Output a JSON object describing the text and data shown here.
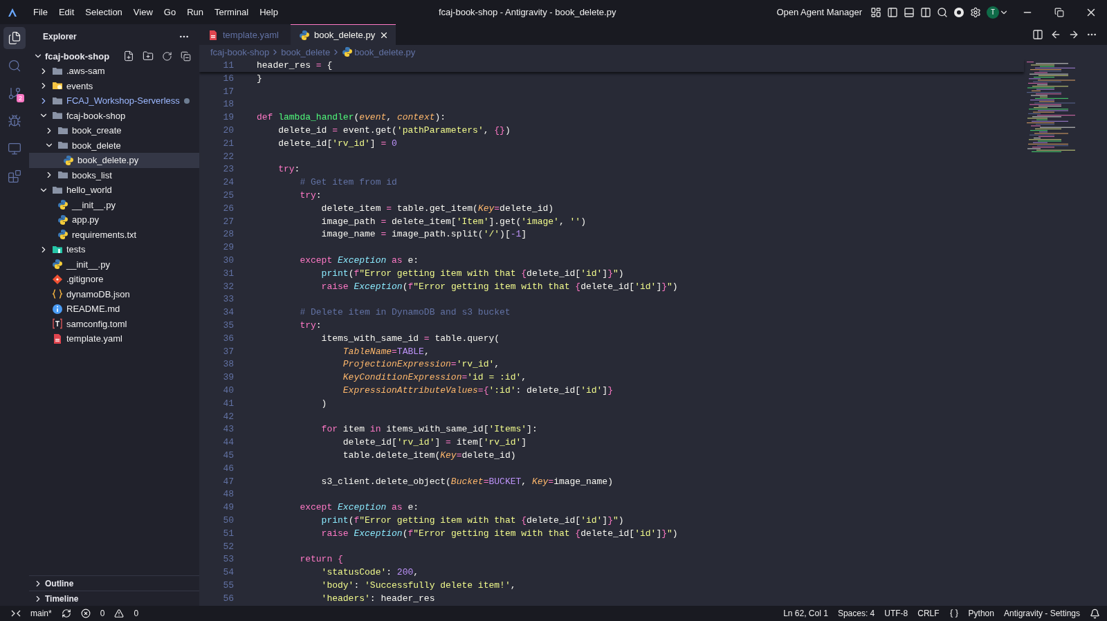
{
  "window": {
    "title": "fcaj-book-shop - Antigravity - book_delete.py",
    "menu": [
      "File",
      "Edit",
      "Selection",
      "View",
      "Go",
      "Run",
      "Terminal",
      "Help"
    ],
    "agent_button": "Open Agent Manager",
    "avatar": "T"
  },
  "activity_bar": [
    {
      "kind": "explorer",
      "selected": true
    },
    {
      "kind": "search",
      "selected": false
    },
    {
      "kind": "source-control",
      "selected": false,
      "badge": "2"
    },
    {
      "kind": "run-debug",
      "selected": false
    },
    {
      "kind": "remote",
      "selected": false
    },
    {
      "kind": "extensions",
      "selected": false
    }
  ],
  "sidebar": {
    "title": "Explorer",
    "root": {
      "label": "fcaj-book-shop",
      "expanded": true
    },
    "items": [
      {
        "label": ".aws-sam",
        "kind": "folder",
        "expanded": false,
        "selected": false
      },
      {
        "label": "events",
        "kind": "folder-events",
        "expanded": false,
        "selected": false
      },
      {
        "label": "FCAJ_Workshop-Serverless",
        "kind": "folder",
        "expanded": false,
        "selected": false,
        "modified": true
      },
      {
        "label": "fcaj-book-shop",
        "kind": "folder",
        "expanded": true,
        "selected": false,
        "children": [
          {
            "label": "book_create",
            "kind": "folder",
            "expanded": false,
            "selected": false
          },
          {
            "label": "book_delete",
            "kind": "folder",
            "expanded": true,
            "selected": false,
            "children": [
              {
                "label": "book_delete.py",
                "kind": "python",
                "selected": true
              }
            ]
          },
          {
            "label": "books_list",
            "kind": "folder",
            "expanded": false,
            "selected": false
          }
        ]
      },
      {
        "label": "hello_world",
        "kind": "folder",
        "expanded": true,
        "selected": false,
        "children": [
          {
            "label": "__init__.py",
            "kind": "python",
            "selected": false
          },
          {
            "label": "app.py",
            "kind": "python",
            "selected": false
          },
          {
            "label": "requirements.txt",
            "kind": "requirements",
            "selected": false
          }
        ]
      },
      {
        "label": "tests",
        "kind": "folder-tests",
        "expanded": false,
        "selected": false
      },
      {
        "label": "__init__.py",
        "kind": "python",
        "selected": false
      },
      {
        "label": ".gitignore",
        "kind": "git",
        "selected": false
      },
      {
        "label": "dynamoDB.json",
        "kind": "json",
        "selected": false
      },
      {
        "label": "README.md",
        "kind": "info",
        "selected": false
      },
      {
        "label": "samconfig.toml",
        "kind": "toml",
        "selected": false
      },
      {
        "label": "template.yaml",
        "kind": "yaml",
        "selected": false
      }
    ],
    "panels": [
      {
        "label": "Outline",
        "expanded": false
      },
      {
        "label": "Timeline",
        "expanded": false
      }
    ]
  },
  "tabs": [
    {
      "label": "template.yaml",
      "kind": "yaml",
      "selected": false
    },
    {
      "label": "book_delete.py",
      "kind": "python",
      "selected": true
    }
  ],
  "breadcrumb": [
    {
      "label": "fcaj-book-shop",
      "kind": "folder"
    },
    {
      "label": "book_delete",
      "kind": "folder"
    },
    {
      "label": "book_delete.py",
      "kind": "python"
    }
  ],
  "editor": {
    "sticky": {
      "number": "11",
      "tokens": [
        {
          "kind": "plain",
          "text": "header_res "
        },
        {
          "kind": "operator",
          "text": "="
        },
        {
          "kind": "plain",
          "text": " {"
        }
      ]
    },
    "lines": [
      {
        "number": "16",
        "tokens": [
          {
            "kind": "plain",
            "text": "}"
          }
        ]
      },
      {
        "number": "17"
      },
      {
        "number": "18"
      },
      {
        "number": "19",
        "tokens": [
          {
            "kind": "keyword",
            "text": "def "
          },
          {
            "kind": "function",
            "text": "lambda_handler"
          },
          {
            "kind": "plain",
            "text": "("
          },
          {
            "kind": "param",
            "text": "event"
          },
          {
            "kind": "plain",
            "text": ", "
          },
          {
            "kind": "param",
            "text": "context"
          },
          {
            "kind": "plain",
            "text": "):"
          }
        ]
      },
      {
        "number": "20",
        "tokens": [
          {
            "kind": "plain",
            "text": "    delete_id "
          },
          {
            "kind": "operator",
            "text": "="
          },
          {
            "kind": "plain",
            "text": " event.get("
          },
          {
            "kind": "string",
            "text": "'pathParameters'"
          },
          {
            "kind": "plain",
            "text": ", "
          },
          {
            "kind": "brace",
            "text": "{}"
          },
          {
            "kind": "plain",
            "text": ")"
          }
        ]
      },
      {
        "number": "21",
        "tokens": [
          {
            "kind": "plain",
            "text": "    delete_id["
          },
          {
            "kind": "string",
            "text": "'rv_id'"
          },
          {
            "kind": "plain",
            "text": "] "
          },
          {
            "kind": "operator",
            "text": "="
          },
          {
            "kind": "number",
            "text": " 0"
          }
        ]
      },
      {
        "number": "22"
      },
      {
        "number": "23",
        "tokens": [
          {
            "kind": "keyword",
            "text": "    try"
          },
          {
            "kind": "plain",
            "text": ":"
          }
        ]
      },
      {
        "number": "24",
        "tokens": [
          {
            "kind": "comment",
            "text": "        # Get item from id"
          }
        ]
      },
      {
        "number": "25",
        "tokens": [
          {
            "kind": "keyword",
            "text": "        try"
          },
          {
            "kind": "plain",
            "text": ":"
          }
        ]
      },
      {
        "number": "26",
        "tokens": [
          {
            "kind": "plain",
            "text": "            delete_item "
          },
          {
            "kind": "operator",
            "text": "="
          },
          {
            "kind": "plain",
            "text": " table.get_item("
          },
          {
            "kind": "param",
            "text": "Key"
          },
          {
            "kind": "operator",
            "text": "="
          },
          {
            "kind": "plain",
            "text": "delete_id)"
          }
        ]
      },
      {
        "number": "27",
        "tokens": [
          {
            "kind": "plain",
            "text": "            image_path "
          },
          {
            "kind": "operator",
            "text": "="
          },
          {
            "kind": "plain",
            "text": " delete_item["
          },
          {
            "kind": "string",
            "text": "'Item'"
          },
          {
            "kind": "plain",
            "text": "].get("
          },
          {
            "kind": "string",
            "text": "'image'"
          },
          {
            "kind": "plain",
            "text": ", "
          },
          {
            "kind": "string",
            "text": "''"
          },
          {
            "kind": "plain",
            "text": ")"
          }
        ]
      },
      {
        "number": "28",
        "tokens": [
          {
            "kind": "plain",
            "text": "            image_name "
          },
          {
            "kind": "operator",
            "text": "="
          },
          {
            "kind": "plain",
            "text": " image_path.split("
          },
          {
            "kind": "string",
            "text": "'/'"
          },
          {
            "kind": "plain",
            "text": ")["
          },
          {
            "kind": "number",
            "text": "-1"
          },
          {
            "kind": "plain",
            "text": "]"
          }
        ]
      },
      {
        "number": "29"
      },
      {
        "number": "30",
        "tokens": [
          {
            "kind": "keyword",
            "text": "        except "
          },
          {
            "kind": "class",
            "text": "Exception"
          },
          {
            "kind": "keyword",
            "text": " as "
          },
          {
            "kind": "plain",
            "text": "e:"
          }
        ]
      },
      {
        "number": "31",
        "tokens": [
          {
            "kind": "builtin",
            "text": "            print"
          },
          {
            "kind": "plain",
            "text": "("
          },
          {
            "kind": "keyword",
            "text": "f"
          },
          {
            "kind": "string",
            "text": "\"Error getting item with that "
          },
          {
            "kind": "brace",
            "text": "{"
          },
          {
            "kind": "plain",
            "text": "delete_id["
          },
          {
            "kind": "string",
            "text": "'id'"
          },
          {
            "kind": "plain",
            "text": "]"
          },
          {
            "kind": "brace",
            "text": "}"
          },
          {
            "kind": "string",
            "text": "\""
          },
          {
            "kind": "plain",
            "text": ")"
          }
        ]
      },
      {
        "number": "32",
        "tokens": [
          {
            "kind": "keyword",
            "text": "            raise "
          },
          {
            "kind": "class",
            "text": "Exception"
          },
          {
            "kind": "plain",
            "text": "("
          },
          {
            "kind": "keyword",
            "text": "f"
          },
          {
            "kind": "string",
            "text": "\"Error getting item with that "
          },
          {
            "kind": "brace",
            "text": "{"
          },
          {
            "kind": "plain",
            "text": "delete_id["
          },
          {
            "kind": "string",
            "text": "'id'"
          },
          {
            "kind": "plain",
            "text": "]"
          },
          {
            "kind": "brace",
            "text": "}"
          },
          {
            "kind": "string",
            "text": "\""
          },
          {
            "kind": "plain",
            "text": ")"
          }
        ]
      },
      {
        "number": "33"
      },
      {
        "number": "34",
        "tokens": [
          {
            "kind": "comment",
            "text": "        # Delete item in DynamoDB and s3 bucket"
          }
        ]
      },
      {
        "number": "35",
        "tokens": [
          {
            "kind": "keyword",
            "text": "        try"
          },
          {
            "kind": "plain",
            "text": ":"
          }
        ]
      },
      {
        "number": "36",
        "tokens": [
          {
            "kind": "plain",
            "text": "            items_with_same_id "
          },
          {
            "kind": "operator",
            "text": "="
          },
          {
            "kind": "plain",
            "text": " table.query("
          }
        ]
      },
      {
        "number": "37",
        "tokens": [
          {
            "kind": "param",
            "text": "                TableName"
          },
          {
            "kind": "operator",
            "text": "="
          },
          {
            "kind": "number",
            "text": "TABLE"
          },
          {
            "kind": "plain",
            "text": ","
          }
        ]
      },
      {
        "number": "38",
        "tokens": [
          {
            "kind": "param",
            "text": "                ProjectionExpression"
          },
          {
            "kind": "operator",
            "text": "="
          },
          {
            "kind": "string",
            "text": "'rv_id'"
          },
          {
            "kind": "plain",
            "text": ","
          }
        ]
      },
      {
        "number": "39",
        "tokens": [
          {
            "kind": "param",
            "text": "                KeyConditionExpression"
          },
          {
            "kind": "operator",
            "text": "="
          },
          {
            "kind": "string",
            "text": "'id = :id'"
          },
          {
            "kind": "plain",
            "text": ","
          }
        ]
      },
      {
        "number": "40",
        "tokens": [
          {
            "kind": "param",
            "text": "                ExpressionAttributeValues"
          },
          {
            "kind": "operator",
            "text": "="
          },
          {
            "kind": "brace",
            "text": "{"
          },
          {
            "kind": "string",
            "text": "':id'"
          },
          {
            "kind": "plain",
            "text": ": delete_id["
          },
          {
            "kind": "string",
            "text": "'id'"
          },
          {
            "kind": "plain",
            "text": "]"
          },
          {
            "kind": "brace",
            "text": "}"
          }
        ]
      },
      {
        "number": "41",
        "tokens": [
          {
            "kind": "plain",
            "text": "            )"
          }
        ]
      },
      {
        "number": "42"
      },
      {
        "number": "43",
        "tokens": [
          {
            "kind": "keyword",
            "text": "            for "
          },
          {
            "kind": "plain",
            "text": "item "
          },
          {
            "kind": "keyword",
            "text": "in "
          },
          {
            "kind": "plain",
            "text": "items_with_same_id["
          },
          {
            "kind": "string",
            "text": "'Items'"
          },
          {
            "kind": "plain",
            "text": "]:"
          }
        ]
      },
      {
        "number": "44",
        "tokens": [
          {
            "kind": "plain",
            "text": "                delete_id["
          },
          {
            "kind": "string",
            "text": "'rv_id'"
          },
          {
            "kind": "plain",
            "text": "] "
          },
          {
            "kind": "operator",
            "text": "="
          },
          {
            "kind": "plain",
            "text": " item["
          },
          {
            "kind": "string",
            "text": "'rv_id'"
          },
          {
            "kind": "plain",
            "text": "]"
          }
        ]
      },
      {
        "number": "45",
        "tokens": [
          {
            "kind": "plain",
            "text": "                table.delete_item("
          },
          {
            "kind": "param",
            "text": "Key"
          },
          {
            "kind": "operator",
            "text": "="
          },
          {
            "kind": "plain",
            "text": "delete_id)"
          }
        ]
      },
      {
        "number": "46"
      },
      {
        "number": "47",
        "tokens": [
          {
            "kind": "plain",
            "text": "            s3_client.delete_object("
          },
          {
            "kind": "param",
            "text": "Bucket"
          },
          {
            "kind": "operator",
            "text": "="
          },
          {
            "kind": "number",
            "text": "BUCKET"
          },
          {
            "kind": "plain",
            "text": ", "
          },
          {
            "kind": "param",
            "text": "Key"
          },
          {
            "kind": "operator",
            "text": "="
          },
          {
            "kind": "plain",
            "text": "image_name)"
          }
        ]
      },
      {
        "number": "48"
      },
      {
        "number": "49",
        "tokens": [
          {
            "kind": "keyword",
            "text": "        except "
          },
          {
            "kind": "class",
            "text": "Exception"
          },
          {
            "kind": "keyword",
            "text": " as "
          },
          {
            "kind": "plain",
            "text": "e:"
          }
        ]
      },
      {
        "number": "50",
        "tokens": [
          {
            "kind": "builtin",
            "text": "            print"
          },
          {
            "kind": "plain",
            "text": "("
          },
          {
            "kind": "keyword",
            "text": "f"
          },
          {
            "kind": "string",
            "text": "\"Error getting item with that "
          },
          {
            "kind": "brace",
            "text": "{"
          },
          {
            "kind": "plain",
            "text": "delete_id["
          },
          {
            "kind": "string",
            "text": "'id'"
          },
          {
            "kind": "plain",
            "text": "]"
          },
          {
            "kind": "brace",
            "text": "}"
          },
          {
            "kind": "string",
            "text": "\""
          },
          {
            "kind": "plain",
            "text": ")"
          }
        ]
      },
      {
        "number": "51",
        "tokens": [
          {
            "kind": "keyword",
            "text": "            raise "
          },
          {
            "kind": "class",
            "text": "Exception"
          },
          {
            "kind": "plain",
            "text": "("
          },
          {
            "kind": "keyword",
            "text": "f"
          },
          {
            "kind": "string",
            "text": "\"Error getting item with that "
          },
          {
            "kind": "brace",
            "text": "{"
          },
          {
            "kind": "plain",
            "text": "delete_id["
          },
          {
            "kind": "string",
            "text": "'id'"
          },
          {
            "kind": "plain",
            "text": "]"
          },
          {
            "kind": "brace",
            "text": "}"
          },
          {
            "kind": "string",
            "text": "\""
          },
          {
            "kind": "plain",
            "text": ")"
          }
        ]
      },
      {
        "number": "52"
      },
      {
        "number": "53",
        "tokens": [
          {
            "kind": "keyword",
            "text": "        return "
          },
          {
            "kind": "brace",
            "text": "{"
          }
        ]
      },
      {
        "number": "54",
        "tokens": [
          {
            "kind": "string",
            "text": "            'statusCode'"
          },
          {
            "kind": "plain",
            "text": ": "
          },
          {
            "kind": "number",
            "text": "200"
          },
          {
            "kind": "plain",
            "text": ","
          }
        ]
      },
      {
        "number": "55",
        "tokens": [
          {
            "kind": "string",
            "text": "            'body'"
          },
          {
            "kind": "plain",
            "text": ": "
          },
          {
            "kind": "string",
            "text": "'Successfully delete item!'"
          },
          {
            "kind": "plain",
            "text": ","
          }
        ]
      },
      {
        "number": "56",
        "tokens": [
          {
            "kind": "string",
            "text": "            'headers'"
          },
          {
            "kind": "plain",
            "text": ": header_res"
          }
        ]
      }
    ]
  },
  "status_bar": {
    "branch": "main*",
    "errors": "0",
    "warnings": "0",
    "position": "Ln 62, Col 1",
    "indent": "Spaces: 4",
    "encoding": "UTF-8",
    "eol": "CRLF",
    "language": "Python",
    "settings": "Antigravity - Settings"
  }
}
